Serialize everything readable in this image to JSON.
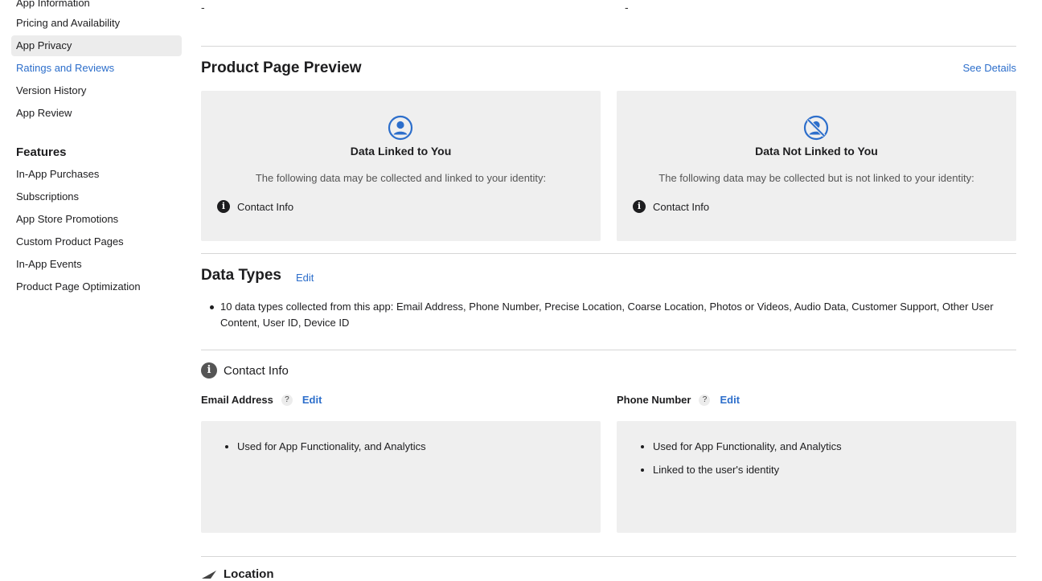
{
  "sidebar": {
    "items": [
      {
        "label": "App Information"
      },
      {
        "label": "Pricing and Availability"
      },
      {
        "label": "App Privacy"
      },
      {
        "label": "Ratings and Reviews"
      },
      {
        "label": "Version History"
      },
      {
        "label": "App Review"
      }
    ],
    "features_heading": "Features",
    "features": [
      {
        "label": "In-App Purchases"
      },
      {
        "label": "Subscriptions"
      },
      {
        "label": "App Store Promotions"
      },
      {
        "label": "Custom Product Pages"
      },
      {
        "label": "In-App Events"
      },
      {
        "label": "Product Page Optimization"
      }
    ]
  },
  "top_values": {
    "left": "-",
    "right": "-"
  },
  "preview": {
    "title": "Product Page Preview",
    "see_details": "See Details",
    "linked": {
      "title": "Data Linked to You",
      "subtitle": "The following data may be collected and linked to your identity:",
      "item": "Contact Info"
    },
    "not_linked": {
      "title": "Data Not Linked to You",
      "subtitle": "The following data may be collected but is not linked to your identity:",
      "item": "Contact Info"
    }
  },
  "data_types": {
    "title": "Data Types",
    "edit": "Edit",
    "summary": "10 data types collected from this app: Email Address, Phone Number, Precise Location, Coarse Location, Photos or Videos, Audio Data, Customer Support, Other User Content, User ID, Device ID"
  },
  "contact_info": {
    "title": "Contact Info",
    "email": {
      "label": "Email Address",
      "help": "?",
      "edit": "Edit",
      "usages": [
        "Used for App Functionality, and Analytics"
      ]
    },
    "phone": {
      "label": "Phone Number",
      "help": "?",
      "edit": "Edit",
      "usages": [
        "Used for App Functionality, and Analytics",
        "Linked to the user's identity"
      ]
    }
  },
  "location": {
    "title": "Location"
  },
  "colors": {
    "link": "#2c6ecb",
    "card_bg": "#efefef",
    "active_bg": "#ececec"
  }
}
